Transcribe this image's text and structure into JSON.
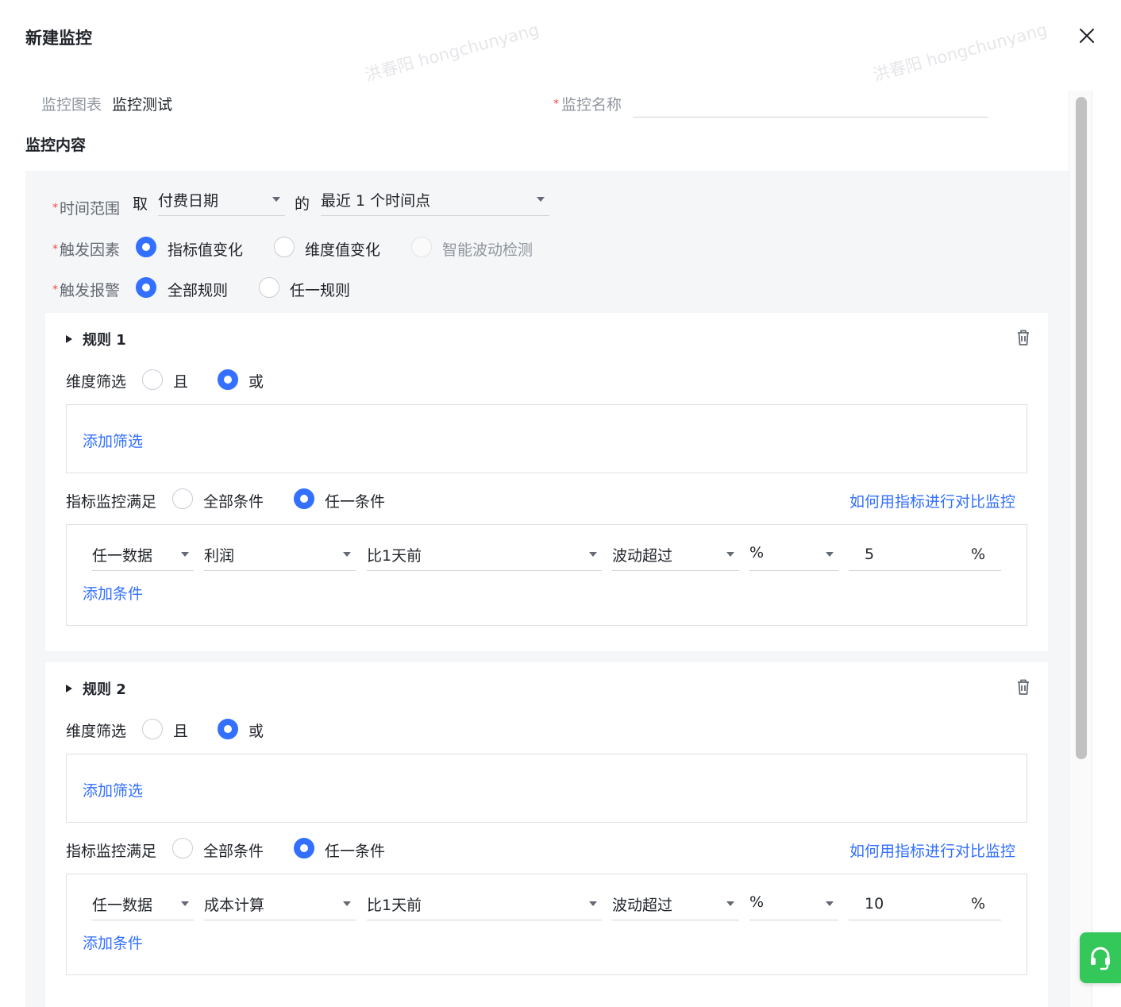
{
  "dialog": {
    "title": "新建监控"
  },
  "form": {
    "chart_label": "监控图表",
    "chart_value": "监控测试",
    "name_label": "监控名称",
    "name_value": "",
    "section_title": "监控内容"
  },
  "time_range": {
    "label": "时间范围",
    "take": "取",
    "field": "付费日期",
    "of": "的",
    "period": "最近 1 个时间点"
  },
  "trigger_factor": {
    "label": "触发因素",
    "options": [
      {
        "label": "指标值变化",
        "selected": true
      },
      {
        "label": "维度值变化",
        "selected": false
      },
      {
        "label": "智能波动检测",
        "selected": false,
        "disabled": true
      }
    ]
  },
  "trigger_alert": {
    "label": "触发报警",
    "options": [
      {
        "label": "全部规则",
        "selected": true
      },
      {
        "label": "任一规则",
        "selected": false
      }
    ]
  },
  "rules": [
    {
      "title": "规则 1",
      "dim_filter_label": "维度筛选",
      "dim_options": [
        {
          "label": "且",
          "selected": false
        },
        {
          "label": "或",
          "selected": true
        }
      ],
      "add_filter": "添加筛选",
      "metric_label": "指标监控满足",
      "metric_options": [
        {
          "label": "全部条件",
          "selected": false
        },
        {
          "label": "任一条件",
          "selected": true
        }
      ],
      "help_link": "如何用指标进行对比监控",
      "condition": {
        "scope": "任一数据",
        "metric": "利润",
        "compare": "比1天前",
        "op": "波动超过",
        "unit_select": "%",
        "value": "5",
        "unit": "%"
      },
      "add_condition": "添加条件"
    },
    {
      "title": "规则 2",
      "dim_filter_label": "维度筛选",
      "dim_options": [
        {
          "label": "且",
          "selected": false
        },
        {
          "label": "或",
          "selected": true
        }
      ],
      "add_filter": "添加筛选",
      "metric_label": "指标监控满足",
      "metric_options": [
        {
          "label": "全部条件",
          "selected": false
        },
        {
          "label": "任一条件",
          "selected": true
        }
      ],
      "help_link": "如何用指标进行对比监控",
      "condition": {
        "scope": "任一数据",
        "metric": "成本计算",
        "compare": "比1天前",
        "op": "波动超过",
        "unit_select": "%",
        "value": "10",
        "unit": "%"
      },
      "add_condition": "添加条件"
    }
  ],
  "watermark": "洪春阳 hongchunyang",
  "colors": {
    "accent": "#3370ff",
    "required": "#f54a45",
    "help_button": "#34c759"
  },
  "icons": [
    "close-icon",
    "caret-down-icon",
    "expand-triangle-icon",
    "trash-icon",
    "headset-icon"
  ]
}
